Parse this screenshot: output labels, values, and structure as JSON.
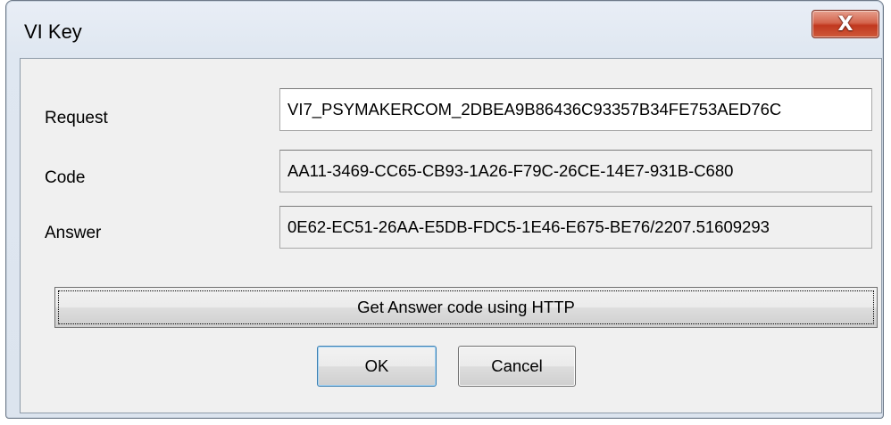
{
  "window": {
    "title": "VI Key",
    "close_glyph": "X"
  },
  "form": {
    "request": {
      "label": "Request",
      "value": "VI7_PSYMAKERCOM_2DBEA9B86436C93357B34FE753AED76C"
    },
    "code": {
      "label": "Code",
      "value": "AA11-3469-CC65-CB93-1A26-F79C-26CE-14E7-931B-C680"
    },
    "answer": {
      "label": "Answer",
      "value": "0E62-EC51-26AA-E5DB-FDC5-1E46-E675-BE76/2207.51609293"
    }
  },
  "buttons": {
    "http_label": "Get Answer code using HTTP",
    "ok_label": "OK",
    "cancel_label": "Cancel"
  },
  "colors": {
    "close_button": "#c1381f",
    "dialog_background": "#f0f0f0",
    "frame": "#dce4ee"
  },
  "icons": {
    "close": "close-icon"
  }
}
